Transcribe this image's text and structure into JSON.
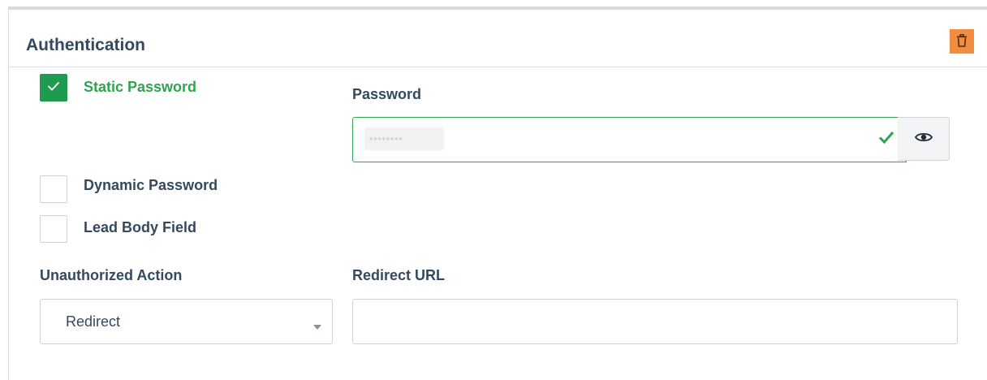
{
  "panel": {
    "title": "Authentication"
  },
  "options": {
    "static_password": {
      "label": "Static Password",
      "checked": true
    },
    "dynamic_password": {
      "label": "Dynamic Password",
      "checked": false
    },
    "lead_body_field": {
      "label": "Lead Body Field",
      "checked": false
    }
  },
  "password": {
    "label": "Password",
    "masked_value": "••••••••"
  },
  "unauthorized_action": {
    "label": "Unauthorized Action",
    "selected": "Redirect"
  },
  "redirect_url": {
    "label": "Redirect URL",
    "value": ""
  },
  "icons": {
    "delete": "trash-icon",
    "visibility": "eye-icon",
    "valid": "checkmark-icon",
    "dropdown": "caret-down-icon"
  },
  "colors": {
    "accent_green": "#2ea44f",
    "checkbox_green": "#1f9b4f",
    "delete_orange": "#f28c3e",
    "text": "#34495e"
  }
}
